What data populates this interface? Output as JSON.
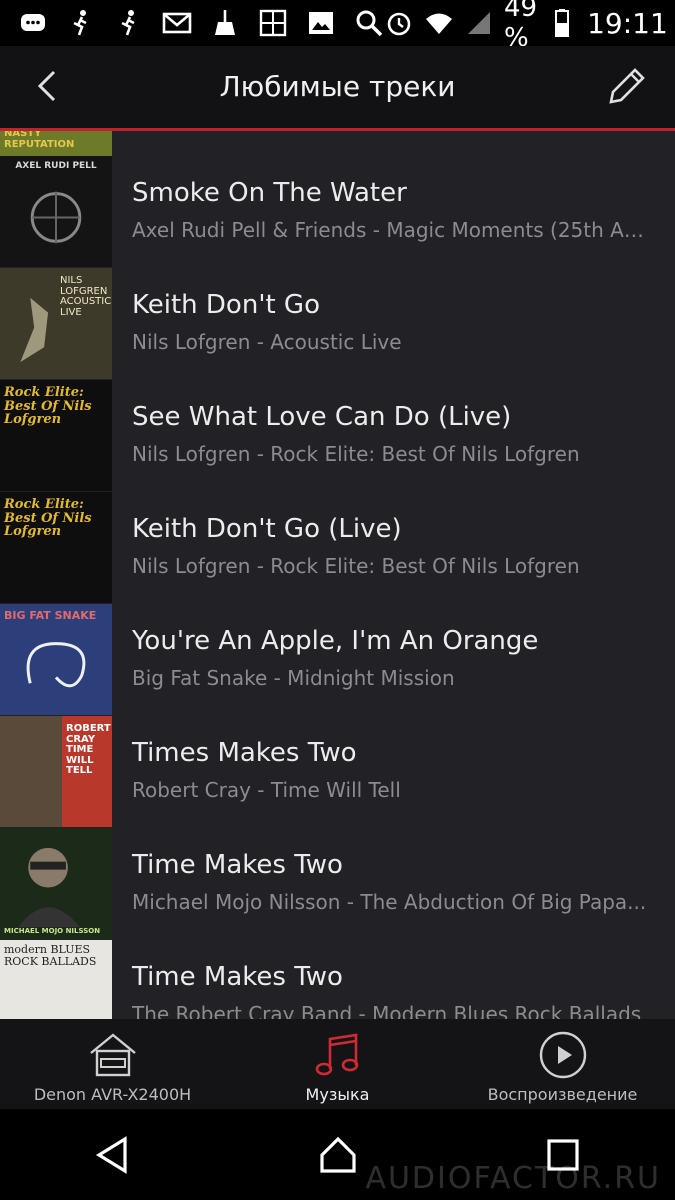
{
  "status_bar": {
    "battery": "49 %",
    "time": "19:11",
    "icons": [
      "chat-icon",
      "runner-icon",
      "runner-icon",
      "mail-icon",
      "broom-icon",
      "gallery-icon",
      "image-icon",
      "search-icon",
      "alarm-icon",
      "wifi-icon",
      "signal-icon",
      "battery-icon"
    ]
  },
  "header": {
    "title": "Любимые треки",
    "back_icon": "chevron-left-icon",
    "edit_icon": "pencil-icon"
  },
  "tracks": [
    {
      "title": "",
      "subtitle": "",
      "art": {
        "text": "NASTY REPUTATION",
        "bg": "#6c7a2a",
        "fg": "#e7c94a"
      }
    },
    {
      "title": "Smoke On The Water",
      "subtitle": "Axel Rudi Pell & Friends - Magic Moments (25th An...",
      "art": {
        "text": "AXEL RUDI PELL",
        "bg": "#141414",
        "fg": "#d8d8d8"
      }
    },
    {
      "title": "Keith Don't Go",
      "subtitle": "Nils Lofgren - Acoustic Live",
      "art": {
        "text": "NILS LOFGREN ACOUSTIC LIVE",
        "bg": "#3d3a2a",
        "fg": "#f0e9c8"
      }
    },
    {
      "title": "See What Love Can Do (Live)",
      "subtitle": "Nils Lofgren - Rock Elite: Best Of Nils Lofgren",
      "art": {
        "text": "Rock Elite: Best Of Nils Lofgren",
        "bg": "#0e0e0e",
        "fg": "#e3b92e"
      }
    },
    {
      "title": "Keith Don't Go (Live)",
      "subtitle": "Nils Lofgren - Rock Elite: Best Of Nils Lofgren",
      "art": {
        "text": "Rock Elite: Best Of Nils Lofgren",
        "bg": "#0e0e0e",
        "fg": "#e3b92e"
      }
    },
    {
      "title": "You're An Apple, I'm An Orange",
      "subtitle": "Big Fat Snake - Midnight Mission",
      "art": {
        "text": "BIG FAT SNAKE",
        "bg": "#2c3f7a",
        "fg": "#e36a6a"
      }
    },
    {
      "title": "Times Makes Two",
      "subtitle": "Robert Cray - Time Will Tell",
      "art": {
        "text": "ROBERT CRAY TIME WILL TELL",
        "bg": "#b8392c",
        "fg": "#ffffff"
      }
    },
    {
      "title": "Time Makes Two",
      "subtitle": "Michael Mojo Nilsson - The Abduction Of Big Papa...",
      "art": {
        "text": "MICHAEL MOJO NILSSON",
        "bg": "#1c2a1a",
        "fg": "#c8e68a"
      }
    },
    {
      "title": "Time Makes Two",
      "subtitle": "The Robert Cray Band - Modern Blues Rock Ballads",
      "art": {
        "text": "modern BLUES ROCK BALLADS",
        "bg": "#e8e6e1",
        "fg": "#222222"
      }
    }
  ],
  "bottom_nav": [
    {
      "label": "Denon AVR-X2400H",
      "icon": "house-icon",
      "active": false
    },
    {
      "label": "Музыка",
      "icon": "music-note-icon",
      "active": true
    },
    {
      "label": "Воспроизведение",
      "icon": "play-circle-icon",
      "active": false
    }
  ],
  "system_nav": [
    "back-triangle-icon",
    "home-icon",
    "recents-icon"
  ],
  "watermark": "AUDIOFACTOR.RU",
  "colors": {
    "accent": "#c2202a",
    "background": "#222226",
    "header": "#121214"
  }
}
